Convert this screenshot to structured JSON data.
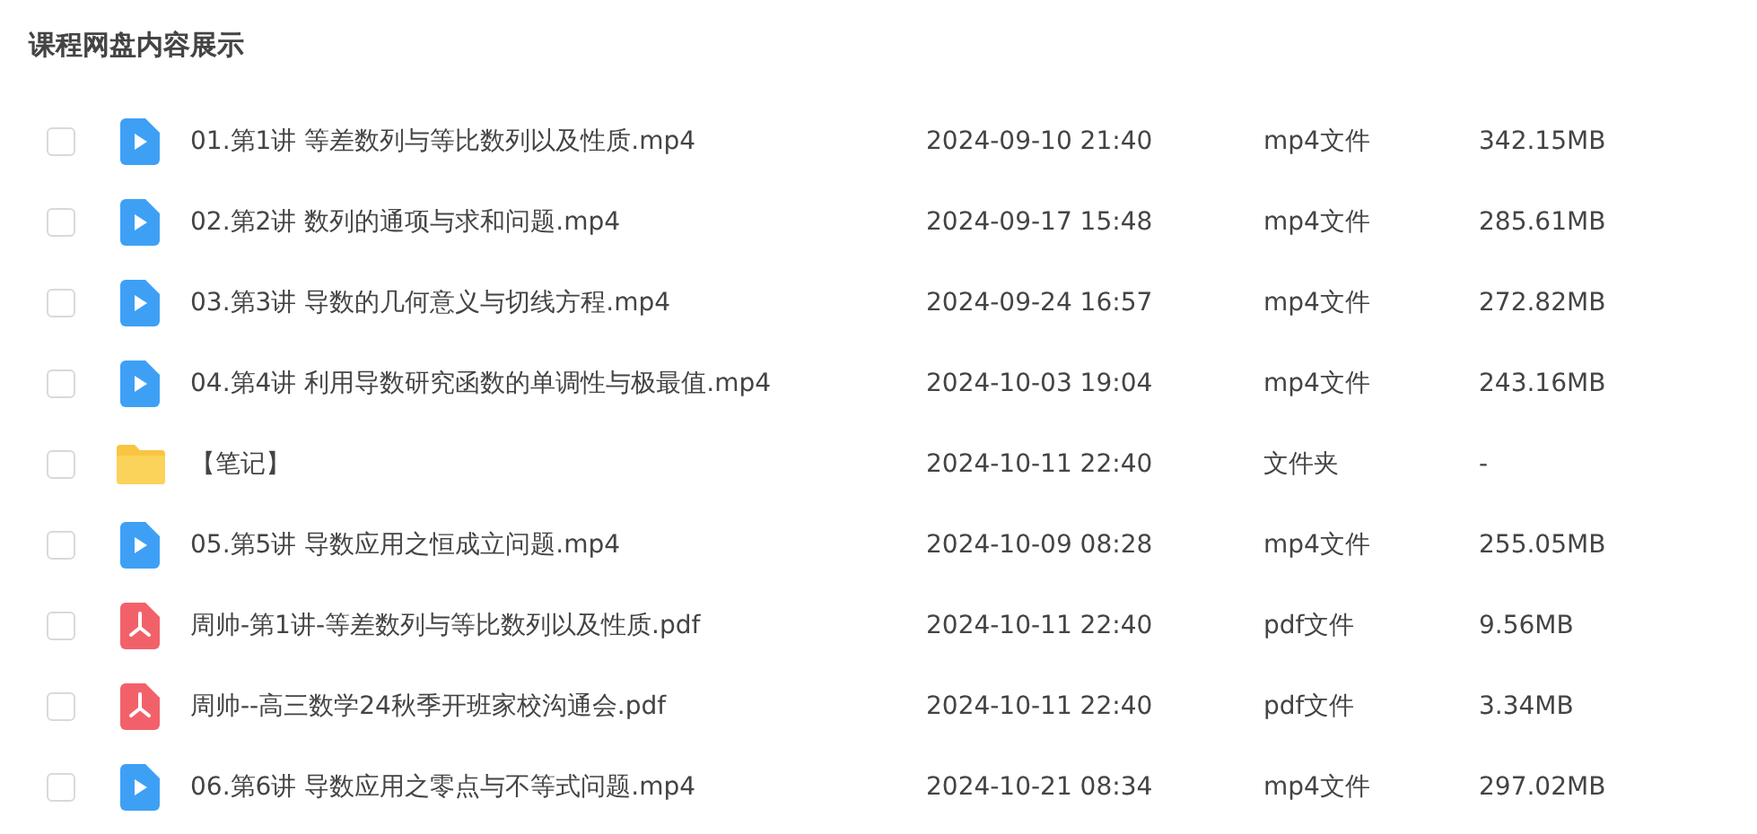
{
  "title": "课程网盘内容展示",
  "files": [
    {
      "kind": "video",
      "checked": false,
      "name": "01.第1讲 等差数列与等比数列以及性质.mp4",
      "modified": "2024-09-10 21:40",
      "type": "mp4文件",
      "size": "342.15MB"
    },
    {
      "kind": "video",
      "checked": false,
      "name": "02.第2讲 数列的通项与求和问题.mp4",
      "modified": "2024-09-17 15:48",
      "type": "mp4文件",
      "size": "285.61MB"
    },
    {
      "kind": "video",
      "checked": false,
      "name": "03.第3讲 导数的几何意义与切线方程.mp4",
      "modified": "2024-09-24 16:57",
      "type": "mp4文件",
      "size": "272.82MB"
    },
    {
      "kind": "video",
      "checked": false,
      "name": "04.第4讲 利用导数研究函数的单调性与极最值.mp4",
      "modified": "2024-10-03 19:04",
      "type": "mp4文件",
      "size": "243.16MB"
    },
    {
      "kind": "folder",
      "checked": false,
      "name": "【笔记】",
      "modified": "2024-10-11 22:40",
      "type": "文件夹",
      "size": "-"
    },
    {
      "kind": "video",
      "checked": false,
      "name": "05.第5讲 导数应用之恒成立问题.mp4",
      "modified": "2024-10-09 08:28",
      "type": "mp4文件",
      "size": "255.05MB"
    },
    {
      "kind": "pdf",
      "checked": false,
      "name": "周帅-第1讲-等差数列与等比数列以及性质.pdf",
      "modified": "2024-10-11 22:40",
      "type": "pdf文件",
      "size": "9.56MB"
    },
    {
      "kind": "pdf",
      "checked": false,
      "name": "周帅--高三数学24秋季开班家校沟通会.pdf",
      "modified": "2024-10-11 22:40",
      "type": "pdf文件",
      "size": "3.34MB"
    },
    {
      "kind": "video",
      "checked": false,
      "name": "06.第6讲 导数应用之零点与不等式问题.mp4",
      "modified": "2024-10-21 08:34",
      "type": "mp4文件",
      "size": "297.02MB"
    }
  ]
}
